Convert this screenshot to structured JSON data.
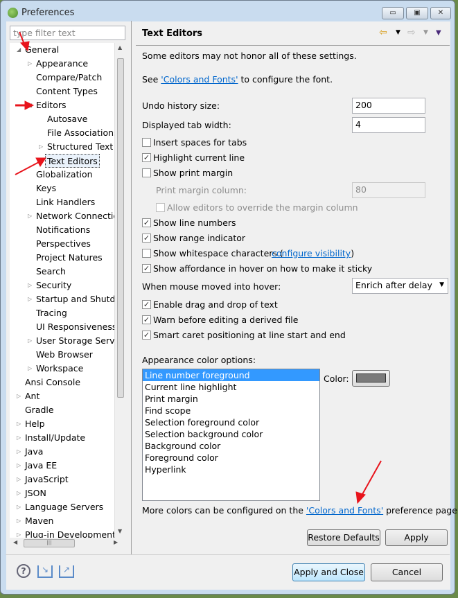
{
  "window": {
    "title": "Preferences",
    "minimize": "▭",
    "maximize": "▣",
    "close": "✕"
  },
  "sidebar": {
    "filter_placeholder": "type filter text",
    "items": [
      {
        "label": "General",
        "level": 0,
        "state": "expanded"
      },
      {
        "label": "Appearance",
        "level": 1,
        "state": "collapsed"
      },
      {
        "label": "Compare/Patch",
        "level": 1,
        "state": "leaf"
      },
      {
        "label": "Content Types",
        "level": 1,
        "state": "leaf"
      },
      {
        "label": "Editors",
        "level": 1,
        "state": "expanded"
      },
      {
        "label": "Autosave",
        "level": 2,
        "state": "leaf"
      },
      {
        "label": "File Associations",
        "level": 2,
        "state": "leaf"
      },
      {
        "label": "Structured Text Editors",
        "level": 2,
        "state": "collapsed"
      },
      {
        "label": "Text Editors",
        "level": 2,
        "state": "selected"
      },
      {
        "label": "Globalization",
        "level": 1,
        "state": "leaf"
      },
      {
        "label": "Keys",
        "level": 1,
        "state": "leaf"
      },
      {
        "label": "Link Handlers",
        "level": 1,
        "state": "leaf"
      },
      {
        "label": "Network Connections",
        "level": 1,
        "state": "collapsed"
      },
      {
        "label": "Notifications",
        "level": 1,
        "state": "leaf"
      },
      {
        "label": "Perspectives",
        "level": 1,
        "state": "leaf"
      },
      {
        "label": "Project Natures",
        "level": 1,
        "state": "leaf"
      },
      {
        "label": "Search",
        "level": 1,
        "state": "leaf"
      },
      {
        "label": "Security",
        "level": 1,
        "state": "collapsed"
      },
      {
        "label": "Startup and Shutdown",
        "level": 1,
        "state": "collapsed"
      },
      {
        "label": "Tracing",
        "level": 1,
        "state": "leaf"
      },
      {
        "label": "UI Responsiveness",
        "level": 1,
        "state": "leaf"
      },
      {
        "label": "User Storage Service",
        "level": 1,
        "state": "collapsed"
      },
      {
        "label": "Web Browser",
        "level": 1,
        "state": "leaf"
      },
      {
        "label": "Workspace",
        "level": 1,
        "state": "collapsed"
      },
      {
        "label": "Ansi Console",
        "level": 0,
        "state": "leaf"
      },
      {
        "label": "Ant",
        "level": 0,
        "state": "collapsed"
      },
      {
        "label": "Gradle",
        "level": 0,
        "state": "leaf"
      },
      {
        "label": "Help",
        "level": 0,
        "state": "collapsed"
      },
      {
        "label": "Install/Update",
        "level": 0,
        "state": "collapsed"
      },
      {
        "label": "Java",
        "level": 0,
        "state": "collapsed"
      },
      {
        "label": "Java EE",
        "level": 0,
        "state": "collapsed"
      },
      {
        "label": "JavaScript",
        "level": 0,
        "state": "collapsed"
      },
      {
        "label": "JSON",
        "level": 0,
        "state": "collapsed"
      },
      {
        "label": "Language Servers",
        "level": 0,
        "state": "collapsed"
      },
      {
        "label": "Maven",
        "level": 0,
        "state": "collapsed"
      },
      {
        "label": "Plug-in Development",
        "level": 0,
        "state": "collapsed"
      }
    ]
  },
  "page": {
    "title": "Text Editors",
    "note": "Some editors may not honor all of these settings.",
    "see_prefix": "See ",
    "see_link": "'Colors and Fonts'",
    "see_suffix": " to configure the font.",
    "undo_label": "Undo history size:",
    "undo_value": "200",
    "tab_label": "Displayed tab width:",
    "tab_value": "4",
    "checks": [
      {
        "label": "Insert spaces for tabs",
        "checked": false
      },
      {
        "label": "Highlight current line",
        "checked": true
      },
      {
        "label": "Show print margin",
        "checked": false
      }
    ],
    "margin_col_label": "Print margin column:",
    "margin_col_value": "80",
    "allow_override": "Allow editors to override the margin column",
    "checks2": [
      {
        "label": "Show line numbers",
        "checked": true
      },
      {
        "label": "Show range indicator",
        "checked": true
      },
      {
        "label": "Show whitespace characters (",
        "checked": false
      },
      {
        "label": "Show affordance in hover on how to make it sticky",
        "checked": true
      }
    ],
    "configure_visibility": "configure visibility",
    "paren_close": ")",
    "hover_label": "When mouse moved into hover:",
    "hover_value": "Enrich after delay",
    "checks3": [
      {
        "label": "Enable drag and drop of text",
        "checked": true
      },
      {
        "label": "Warn before editing a derived file",
        "checked": true
      },
      {
        "label": "Smart caret positioning at line start and end",
        "checked": true
      }
    ],
    "appearance_label": "Appearance color options:",
    "color_items": [
      "Line number foreground",
      "Current line highlight",
      "Print margin",
      "Find scope",
      "Selection foreground color",
      "Selection background color",
      "Background color",
      "Foreground color",
      "Hyperlink"
    ],
    "color_label": "Color:",
    "color_value": "#7a7a7a",
    "more_prefix": "More colors can be configured on the ",
    "more_link": "'Colors and Fonts'",
    "more_suffix": " preference page.",
    "restore": "Restore Defaults",
    "apply": "Apply"
  },
  "footer": {
    "apply_close": "Apply and Close",
    "cancel": "Cancel",
    "help": "?"
  },
  "annotation_color": "#e8141c"
}
